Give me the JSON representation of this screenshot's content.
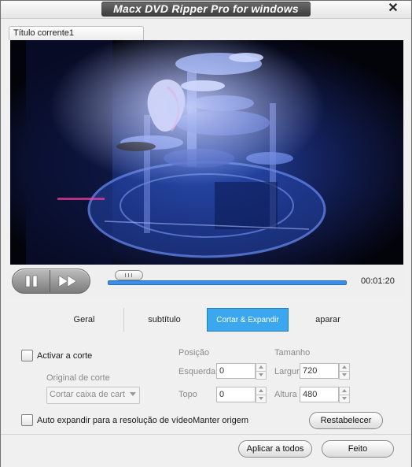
{
  "window": {
    "title": "Macx DVD Ripper Pro for windows",
    "close_glyph": "✕"
  },
  "title_tab": {
    "label": "Título corrente1"
  },
  "playback": {
    "time": "00:01:20",
    "progress_fraction": 0.05
  },
  "tabs": [
    {
      "label": "Geral"
    },
    {
      "label": "subtítulo"
    },
    {
      "label": "Cortar & Expandir"
    },
    {
      "label": "aparar"
    }
  ],
  "crop": {
    "enable_label": "Activar a corte",
    "source_label": "Original de corte",
    "source_value": "Cortar caixa de cart",
    "position_label": "Posição",
    "left_label": "Esquerda",
    "left_value": "0",
    "top_label": "Topo",
    "top_value": "0",
    "size_label": "Tamanho",
    "width_label": "Largur",
    "width_value": "720",
    "height_label": "Altura",
    "height_value": "480",
    "auto_expand_label": "Auto expandir para a resolução de vídeoManter origem",
    "reset_label": "Restabelecer"
  },
  "footer": {
    "apply_all_label": "Aplicar a todos",
    "done_label": "Feito"
  },
  "colors": {
    "accent": "#3aa7ee",
    "progress": "#3b8ee6"
  }
}
